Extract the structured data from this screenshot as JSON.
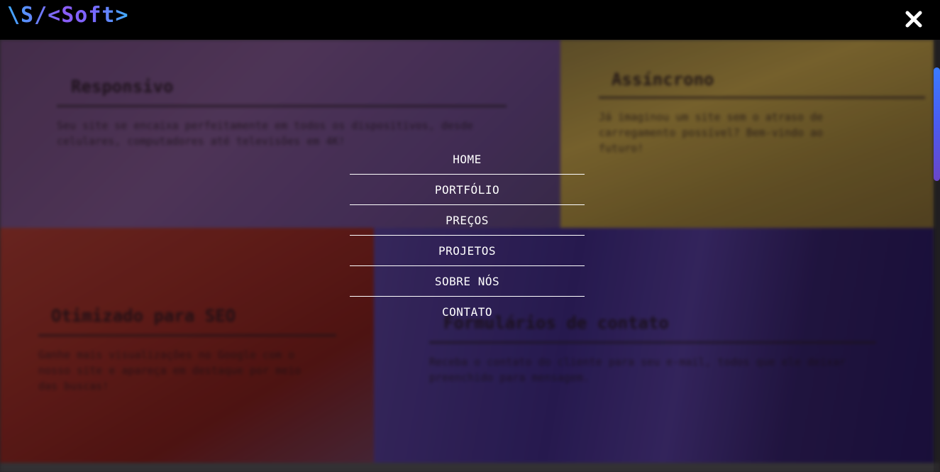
{
  "header": {
    "logo": "\\S/<Soft>",
    "close_icon": "close-icon"
  },
  "menu": {
    "items": [
      "HOME",
      "PORTFÓLIO",
      "PREÇOS",
      "PROJETOS",
      "SOBRE NÓS",
      "CONTATO"
    ]
  },
  "cards": [
    {
      "title": "Responsivo",
      "text": "Seu site se encaixa perfeitamente em todos os dispositivos, desde celulares, computadores até televisões em 4K!"
    },
    {
      "title": "Assíncrono",
      "text": "Já imaginou um site sem o atraso de carregamento possível? Bem-vindo ao futuro!"
    },
    {
      "title": "Otimizado para SEO",
      "text": "Ganhe mais visualizações no Google com o nosso site e apareça em destaque por meio das buscas!"
    },
    {
      "title": "Formulários de contato",
      "text": "Receba o contato do cliente para seu e-mail, todos que ele deixar preenchido para mensagem."
    }
  ],
  "colors": {
    "header_bg": "#000000",
    "menu_text": "#ffffff",
    "logo_gradient_start": "#3fa9ff",
    "logo_gradient_mid": "#8b5cf6",
    "scrollbar_thumb": "#3a7bff"
  }
}
